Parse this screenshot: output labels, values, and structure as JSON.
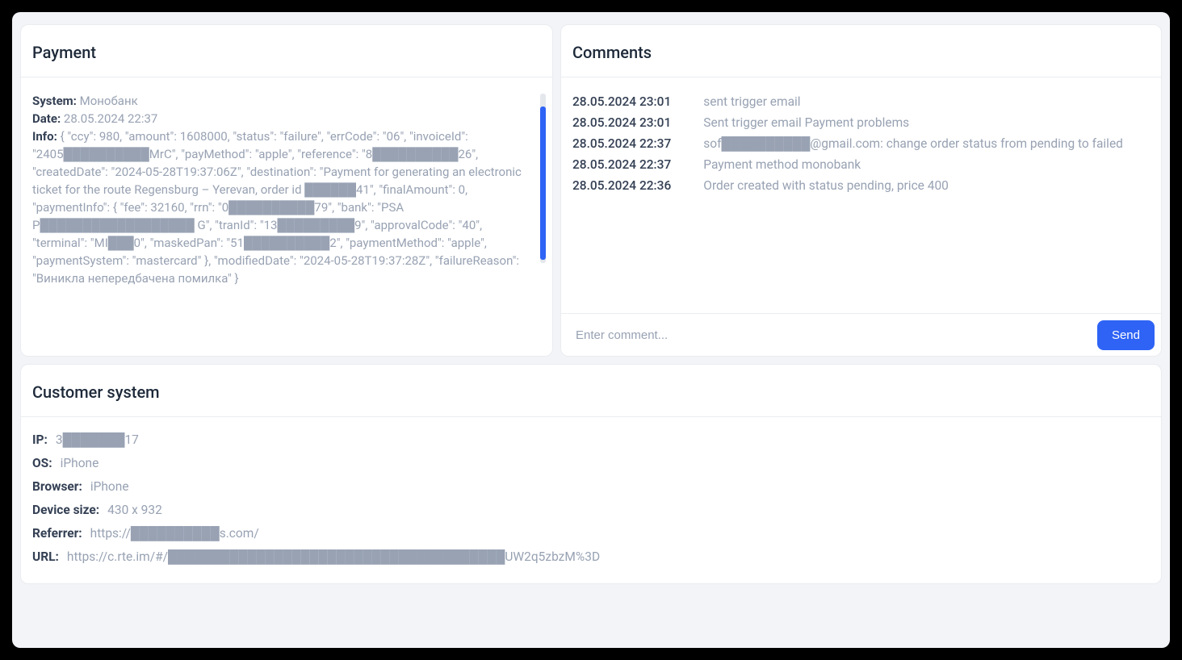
{
  "payment": {
    "title": "Payment",
    "system_label": "System:",
    "system_value": "Монобанк",
    "date_label": "Date:",
    "date_value": "28.05.2024 22:37",
    "info_label": "Info:",
    "info_value": "{ \"ccy\": 980, \"amount\": 1608000, \"status\": \"failure\", \"errCode\": \"06\", \"invoiceId\": \"2405██████████MrC\", \"payMethod\": \"apple\", \"reference\": \"8██████████26\", \"createdDate\": \"2024-05-28T19:37:06Z\", \"destination\": \"Payment for generating an electronic ticket for the route Regensburg – Yerevan, order id ██████41\", \"finalAmount\": 0, \"paymentInfo\": { \"fee\": 32160, \"rrn\": \"0██████████79\", \"bank\": \"PSA P██████████████████ G\", \"tranId\": \"13█████████9\", \"approvalCode\": \"40\", \"terminal\": \"MI███0\", \"maskedPan\": \"51██████████2\", \"paymentMethod\": \"apple\", \"paymentSystem\": \"mastercard\" }, \"modifiedDate\": \"2024-05-28T19:37:28Z\", \"failureReason\": \"Виникла непередбачена помилка\" }"
  },
  "comments": {
    "title": "Comments",
    "items": [
      {
        "date": "28.05.2024 23:01",
        "text": "sent trigger email"
      },
      {
        "date": "28.05.2024 23:01",
        "text": "Sent trigger email Payment problems"
      },
      {
        "date": "28.05.2024 22:37",
        "text": "sof██████████@gmail.com: change order status from pending to failed"
      },
      {
        "date": "28.05.2024 22:37",
        "text": "Payment method monobank"
      },
      {
        "date": "28.05.2024 22:36",
        "text": "Order created with status pending, price 400"
      }
    ],
    "placeholder": "Enter comment...",
    "send_label": "Send"
  },
  "customer": {
    "title": "Customer system",
    "rows": [
      {
        "key": "IP:",
        "val": "3███████17"
      },
      {
        "key": "OS:",
        "val": "iPhone"
      },
      {
        "key": "Browser:",
        "val": "iPhone"
      },
      {
        "key": "Device size:",
        "val": "430 x 932"
      },
      {
        "key": "Referrer:",
        "val": "https://██████████s.com/"
      },
      {
        "key": "URL:",
        "val": "https://c.rte.im/#/██████████████████████████████████████UW2q5zbzM%3D"
      }
    ]
  }
}
